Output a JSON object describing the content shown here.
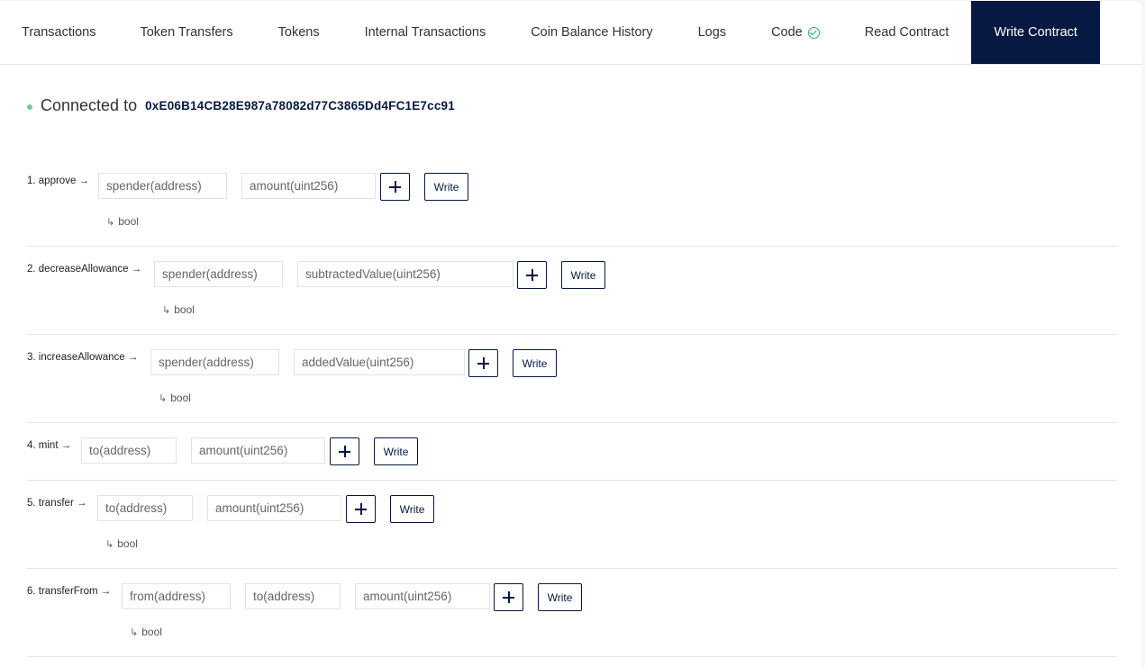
{
  "tabs": [
    {
      "label": "Transactions",
      "active": false
    },
    {
      "label": "Token Transfers",
      "active": false
    },
    {
      "label": "Tokens",
      "active": false
    },
    {
      "label": "Internal Transactions",
      "active": false
    },
    {
      "label": "Coin Balance History",
      "active": false
    },
    {
      "label": "Logs",
      "active": false
    },
    {
      "label": "Code",
      "active": false,
      "icon": "verified-check-icon"
    },
    {
      "label": "Read Contract",
      "active": false
    },
    {
      "label": "Write Contract",
      "active": true
    }
  ],
  "connection": {
    "label": "Connected to",
    "address": "0xE06B14CB28E987a78082d77C3865Dd4FC1E7cc91",
    "status_color": "#6bcf8f"
  },
  "colors": {
    "accent": "#061942",
    "verified": "#20b760"
  },
  "methods": [
    {
      "label": "1. approve →",
      "inputs": [
        "spender(address)",
        "amount(uint256)"
      ],
      "returns": "bool"
    },
    {
      "label": "2. decreaseAllowance →",
      "inputs": [
        "spender(address)",
        "subtractedValue(uint256)"
      ],
      "returns": "bool"
    },
    {
      "label": "3. increaseAllowance →",
      "inputs": [
        "spender(address)",
        "addedValue(uint256)"
      ],
      "returns": "bool"
    },
    {
      "label": "4. mint →",
      "inputs": [
        "to(address)",
        "amount(uint256)"
      ],
      "returns": null
    },
    {
      "label": "5. transfer →",
      "inputs": [
        "to(address)",
        "amount(uint256)"
      ],
      "returns": "bool"
    },
    {
      "label": "6. transferFrom →",
      "inputs": [
        "from(address)",
        "to(address)",
        "amount(uint256)"
      ],
      "returns": "bool"
    }
  ],
  "buttons": {
    "write_label": "Write",
    "add_icon": "plus-icon"
  },
  "return_arrow": "↳"
}
